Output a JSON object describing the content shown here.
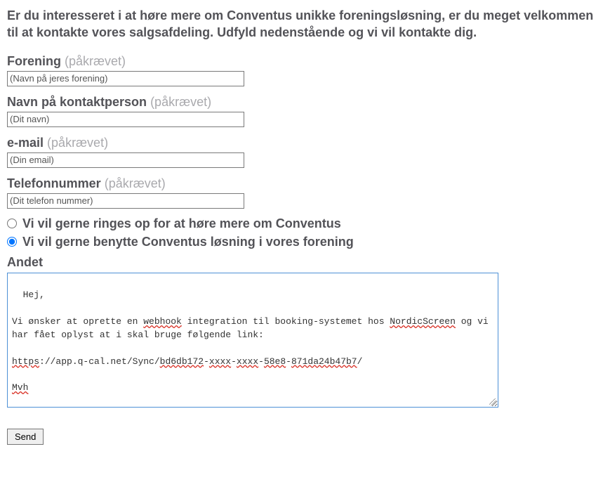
{
  "intro": "Er du interesseret i at høre mere om Conventus unikke foreningsløsning, er du meget velkommen til at kontakte vores salgsafdeling. Udfyld nedenstående og vi vil kontakte dig.",
  "required_suffix": "(påkrævet)",
  "fields": {
    "forening": {
      "label": "Forening",
      "placeholder": "(Navn på jeres forening)",
      "value": ""
    },
    "kontakt": {
      "label": "Navn på kontaktperson",
      "placeholder": "(Dit navn)",
      "value": ""
    },
    "email": {
      "label": "e-mail",
      "placeholder": "(Din email)",
      "value": ""
    },
    "telefon": {
      "label": "Telefonnummer",
      "placeholder": "(Dit telefon nummer)",
      "value": ""
    }
  },
  "radios": {
    "option1": {
      "label": "Vi vil gerne ringes op for at høre mere om Conventus",
      "checked": false
    },
    "option2": {
      "label": "Vi vil gerne benytte Conventus løsning i vores forening",
      "checked": true
    }
  },
  "andet": {
    "label": "Andet",
    "value_plain": "Hej,\n\nVi ønsker at oprette en webhook integration til booking-systemet hos NordicScreen og vi har fået oplyst at i skal bruge følgende link:\n\nhttps://app.q-cal.net/Sync/bd6db172-xxxx-xxxx-58e8-871da24b47b7/\n\nMvh",
    "value_segments": [
      {
        "t": "Hej,",
        "s": false
      },
      {
        "t": "\n\n",
        "s": false
      },
      {
        "t": "Vi ønsker at oprette en ",
        "s": false
      },
      {
        "t": "webhook",
        "s": true
      },
      {
        "t": " integration til booking-systemet hos ",
        "s": false
      },
      {
        "t": "NordicScreen",
        "s": true
      },
      {
        "t": " og vi har fået oplyst at i skal bruge følgende link:",
        "s": false
      },
      {
        "t": "\n\n",
        "s": false
      },
      {
        "t": "https",
        "s": true
      },
      {
        "t": "://app.q-cal.net/Sync/",
        "s": false
      },
      {
        "t": "bd6db172",
        "s": true
      },
      {
        "t": "-",
        "s": false
      },
      {
        "t": "xxxx",
        "s": true
      },
      {
        "t": "-",
        "s": false
      },
      {
        "t": "xxxx",
        "s": true
      },
      {
        "t": "-",
        "s": false
      },
      {
        "t": "58e8",
        "s": true
      },
      {
        "t": "-",
        "s": false
      },
      {
        "t": "871da24b47b7",
        "s": true
      },
      {
        "t": "/",
        "s": false
      },
      {
        "t": "\n\n",
        "s": false
      },
      {
        "t": "Mvh",
        "s": true
      }
    ]
  },
  "submit": {
    "label": "Send"
  }
}
